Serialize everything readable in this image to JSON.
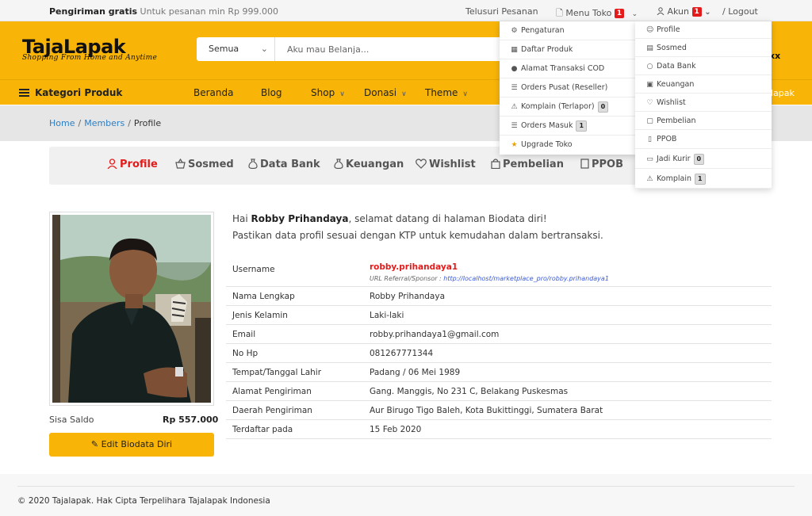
{
  "topbar": {
    "promo_bold": "Pengiriman gratis",
    "promo_text": "Untuk pesanan min Rp 999.000",
    "track": "Telusuri Pesanan",
    "store_menu": "Menu Toko",
    "store_badge": "1",
    "account": "Akun",
    "account_badge": "1",
    "logout": "/ Logout"
  },
  "header": {
    "logo": "TajaLapak",
    "tagline": "Shopping From Home and Anytime",
    "search_category": "Semua",
    "search_placeholder": "Aku mau Belanja...",
    "partial_right": "xx"
  },
  "nav": {
    "categories": "Kategori Produk",
    "items": [
      "Beranda",
      "Blog",
      "Shop",
      "Donasi",
      "Theme"
    ],
    "partial_right": "lapak"
  },
  "breadcrumb": {
    "home": "Home",
    "members": "Members",
    "current": "Profile"
  },
  "tabs": [
    "Profile",
    "Sosmed",
    "Data Bank",
    "Keuangan",
    "Wishlist",
    "Pembelian",
    "PPOB"
  ],
  "profile": {
    "saldo_label": "Sisa Saldo",
    "saldo_value": "Rp 557.000",
    "edit_button": "Edit Biodata Diri",
    "greet_pre": "Hai",
    "greet_name": "Robby Prihandaya",
    "greet_post": ", selamat datang di halaman Biodata diri!",
    "greet_line2": "Pastikan data profil sesuai dengan KTP untuk kemudahan dalam bertransaksi.",
    "referral_label": "URL Referral/Sponsor :",
    "referral_url": "http://localhost/marketplace_pro/robby.prihandaya1",
    "rows": [
      {
        "label": "Username",
        "value": "robby.prihandaya1"
      },
      {
        "label": "Nama Lengkap",
        "value": "Robby Prihandaya"
      },
      {
        "label": "Jenis Kelamin",
        "value": "Laki-laki"
      },
      {
        "label": "Email",
        "value": "robby.prihandaya1@gmail.com"
      },
      {
        "label": "No Hp",
        "value": "081267771344"
      },
      {
        "label": "Tempat/Tanggal Lahir",
        "value": "Padang / 06 Mei 1989"
      },
      {
        "label": "Alamat Pengiriman",
        "value": "Gang. Manggis, No 231 C, Belakang Puskesmas"
      },
      {
        "label": "Daerah Pengiriman",
        "value": "Aur Birugo Tigo Baleh, Kota Bukittinggi, Sumatera Barat"
      },
      {
        "label": "Terdaftar pada",
        "value": "15 Feb 2020"
      }
    ]
  },
  "store_dropdown": [
    {
      "label": "Pengaturan",
      "icon": "cogs-icon"
    },
    {
      "label": "Daftar Produk",
      "icon": "grid-icon"
    },
    {
      "label": "Alamat Transaksi COD",
      "icon": "map-marker-icon"
    },
    {
      "label": "Orders Pusat (Reseller)",
      "icon": "list-icon"
    },
    {
      "label": "Komplain (Terlapor)",
      "icon": "warning-icon",
      "badge": "0"
    },
    {
      "label": "Orders Masuk",
      "icon": "list-icon",
      "badge": "1"
    },
    {
      "label": "Upgrade Toko",
      "icon": "star-icon"
    }
  ],
  "account_dropdown": [
    {
      "label": "Profile",
      "icon": "user-icon"
    },
    {
      "label": "Sosmed",
      "icon": "basket-icon"
    },
    {
      "label": "Data Bank",
      "icon": "money-bag-icon"
    },
    {
      "label": "Keuangan",
      "icon": "money-icon"
    },
    {
      "label": "Wishlist",
      "icon": "heart-icon"
    },
    {
      "label": "Pembelian",
      "icon": "shopping-bag-icon"
    },
    {
      "label": "PPOB",
      "icon": "document-icon"
    },
    {
      "label": "Jadi Kurir",
      "icon": "car-icon",
      "badge": "0"
    },
    {
      "label": "Komplain",
      "icon": "warning-icon",
      "badge": "1"
    }
  ],
  "footer": {
    "copyright": "© 2020 Tajalapak. Hak Cipta Terpelihara Tajalapak Indonesia"
  },
  "colors": {
    "brand_yellow": "#f8b508",
    "accent_red": "#e41b1b",
    "link_blue": "#2a7fc6"
  }
}
